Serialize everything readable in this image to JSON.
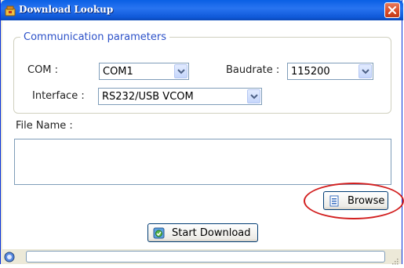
{
  "window": {
    "title": "Download Lookup",
    "icon": "app-icon"
  },
  "comm_group": {
    "legend": "Communication parameters",
    "com_label": "COM :",
    "com_value": "COM1",
    "baud_label": "Baudrate :",
    "baud_value": "115200",
    "interface_label": "Interface :",
    "interface_value": "RS232/USB VCOM"
  },
  "file": {
    "label": "File Name :",
    "value": ""
  },
  "buttons": {
    "browse": "Browse",
    "start_download": "Start Download"
  },
  "status": {
    "progress": 0
  },
  "colors": {
    "title_bar": "#0a5fe4",
    "legend_text": "#2b50c8",
    "highlight_circle": "#d21f1f",
    "dialog_bg": "#ffffff"
  },
  "icons": [
    "app-icon",
    "close-icon",
    "dropdown-arrow-icon",
    "browse-file-icon",
    "start-download-icon",
    "status-icon",
    "resize-grip-icon"
  ]
}
